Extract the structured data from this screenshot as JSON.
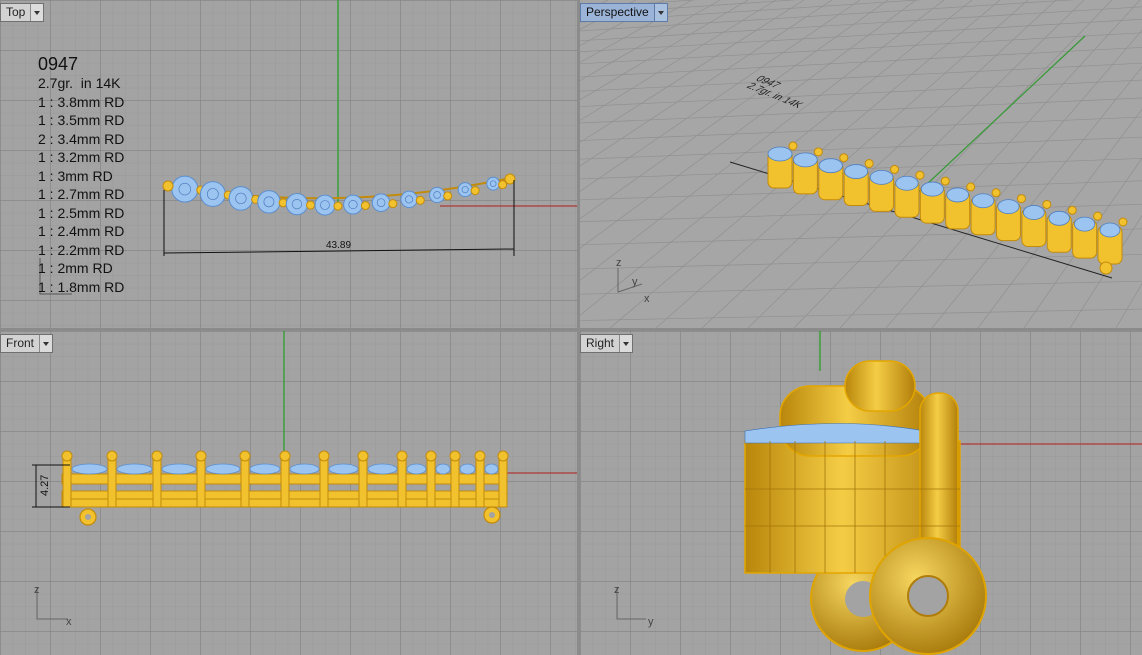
{
  "viewports": {
    "top": {
      "label": "Top"
    },
    "perspective": {
      "label": "Perspective"
    },
    "front": {
      "label": "Front"
    },
    "right": {
      "label": "Right"
    }
  },
  "annotation": {
    "title": "0947",
    "weight": "2.7gr.  in 14K",
    "stones": [
      "1 : 3.8mm RD",
      "1 : 3.5mm RD",
      "2 : 3.4mm RD",
      "1 : 3.2mm RD",
      "1 : 3mm RD",
      "1 : 2.7mm RD",
      "1 : 2.5mm RD",
      "1 : 2.4mm RD",
      "1 : 2.2mm RD",
      "1 : 2mm RD",
      "1 : 1.8mm RD"
    ]
  },
  "dimensions": {
    "length": "43.89",
    "height": "4.27"
  },
  "axes": {
    "x": "x",
    "y": "y",
    "z": "z"
  },
  "colors": {
    "gold": "#f2c12e",
    "gold_dark": "#c38b0a",
    "stone": "#9cc4f0",
    "x_axis": "#b03030",
    "y_axis": "#3a9a3a"
  }
}
